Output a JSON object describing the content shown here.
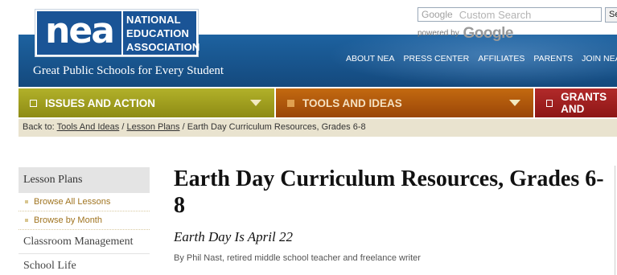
{
  "logo": {
    "mark": "nea",
    "lines": [
      "NATIONAL",
      "EDUCATION",
      "ASSOCIATION"
    ]
  },
  "header": {
    "tagline": "Great Public Schools for Every Student"
  },
  "search": {
    "brand": "Google",
    "placeholder": "Custom Search",
    "button_label": "Se",
    "powered_by": "powered by",
    "powered_brand": "Google"
  },
  "top_nav": [
    "ABOUT NEA",
    "PRESS CENTER",
    "AFFILIATES",
    "PARENTS",
    "JOIN NEA"
  ],
  "menu": [
    {
      "label": "ISSUES AND ACTION"
    },
    {
      "label": "TOOLS AND IDEAS"
    },
    {
      "label": "GRANTS AND"
    }
  ],
  "breadcrumb": {
    "prefix": "Back to:",
    "links": [
      "Tools And Ideas",
      "Lesson Plans"
    ],
    "separator": "/",
    "current": "Earth Day Curriculum Resources, Grades 6-8"
  },
  "sidebar": {
    "header": "Lesson Plans",
    "subitems": [
      "Browse All Lessons",
      "Browse by Month"
    ],
    "items": [
      "Classroom Management",
      "School Life"
    ]
  },
  "article": {
    "title": "Earth Day Curriculum Resources, Grades 6-8",
    "subtitle": "Earth Day Is April 22",
    "byline": "By Phil Nast, retired middle school teacher and freelance writer"
  },
  "colors": {
    "header_blue": "#1d62a0",
    "issues_tab": "#a3a11f",
    "tools_tab": "#b2580c",
    "grants_tab": "#a12020",
    "breadcrumb_bg": "#e9e3cf",
    "sidebar_link": "#a07420"
  },
  "icons": [
    "square-bullet-icon",
    "chevron-down-icon"
  ]
}
